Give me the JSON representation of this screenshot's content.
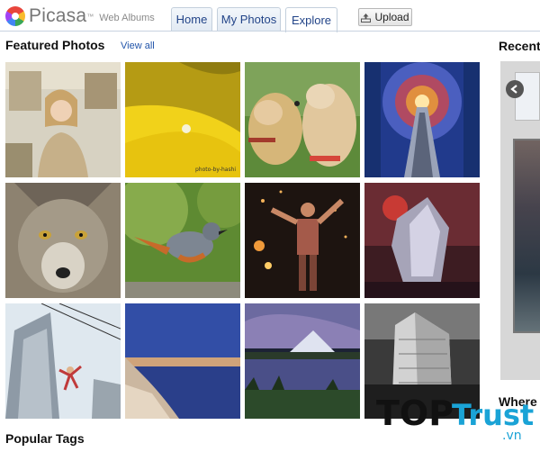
{
  "header": {
    "brand": "Picasa",
    "brand_tm": "™",
    "brand_sub": "Web Albums",
    "tabs": [
      {
        "label": "Home"
      },
      {
        "label": "My Photos"
      },
      {
        "label": "Explore"
      }
    ],
    "upload_label": "Upload"
  },
  "featured": {
    "title": "Featured Photos",
    "view_all": "View all",
    "photos": [
      {
        "name": "woman-smiling-photo"
      },
      {
        "name": "yellow-petal-photo",
        "caption": "photo-by-hashi"
      },
      {
        "name": "dogs-nuzzling-photo"
      },
      {
        "name": "escalator-tunnel-photo"
      },
      {
        "name": "wolf-face-photo"
      },
      {
        "name": "bird-on-branch-photo"
      },
      {
        "name": "fire-dancer-photo"
      },
      {
        "name": "ice-crystal-photo"
      },
      {
        "name": "skyscraper-climber-photo"
      },
      {
        "name": "coastal-town-dusk-photo"
      },
      {
        "name": "mountain-lake-photo"
      },
      {
        "name": "city-building-bw-photo"
      }
    ]
  },
  "sidebar": {
    "recent_title": "Recent",
    "where_title": "Where"
  },
  "popular": {
    "title": "Popular Tags"
  },
  "watermark": {
    "top": "TOP",
    "trust": "Trust",
    "vn": ".vn"
  }
}
